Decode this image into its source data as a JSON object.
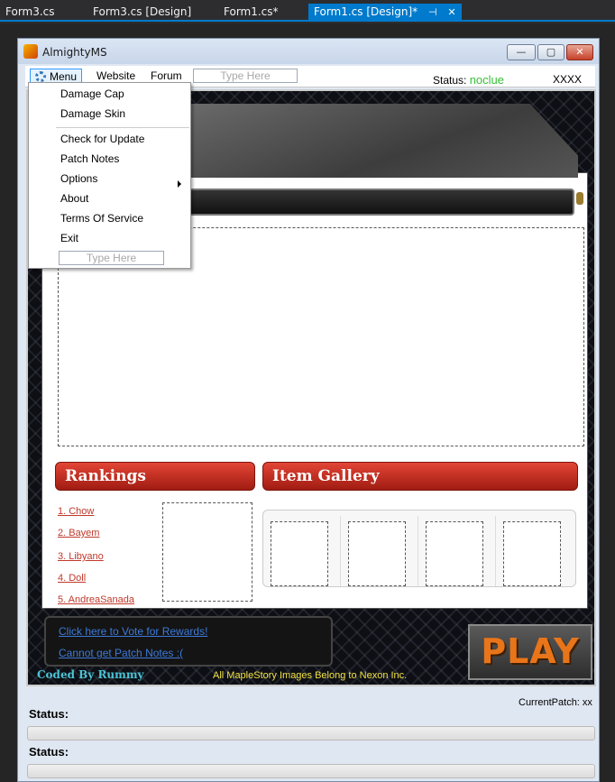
{
  "tabs": [
    {
      "label": "Form3.cs"
    },
    {
      "label": "Form3.cs [Design]"
    },
    {
      "label": "Form1.cs*"
    },
    {
      "label": "Form1.cs [Design]*"
    }
  ],
  "window": {
    "title": "AlmightyMS"
  },
  "menubar": {
    "menu_label": "Menu",
    "website_label": "Website",
    "forum_label": "Forum",
    "type_here": "Type Here",
    "status_label": "Status:",
    "status_value": "noclue",
    "xxxx": "XXXX"
  },
  "dropdown": {
    "items": [
      "Damage Cap",
      "Damage Skin",
      "Check for Update",
      "Patch Notes",
      "Options",
      "About",
      "Terms Of Service",
      "Exit"
    ],
    "type_here": "Type Here"
  },
  "rankings": {
    "title": "Rankings",
    "entries": [
      "1. Chow",
      "2. Bayem",
      "3. Libyano",
      "4. Doll",
      "5. AndreaSanada"
    ]
  },
  "gallery": {
    "title": "Item Gallery"
  },
  "links": {
    "vote": "Click here to Vote for Rewards!",
    "patch_notes": "Cannot get Patch Notes :("
  },
  "play": {
    "label": "PLAY"
  },
  "footer": {
    "credit": "Coded By Rummy",
    "notice": "All MapleStory Images Belong to Nexon Inc."
  },
  "status_area": {
    "current_patch": "CurrentPatch: xx",
    "status_1": "Status:",
    "status_2": "Status:"
  },
  "colors": {
    "accent": "#007acc",
    "status_ok": "#36c236",
    "header_red": "#c0392b"
  }
}
